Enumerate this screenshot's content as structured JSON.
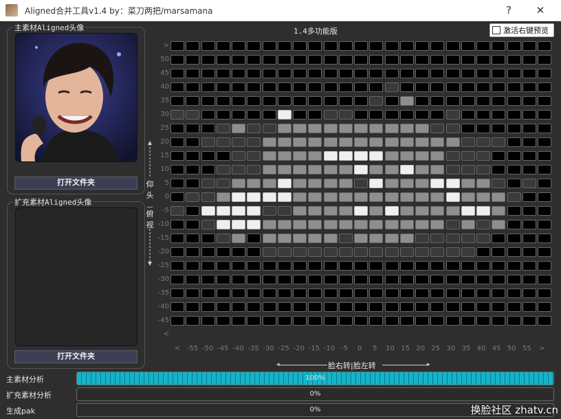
{
  "window": {
    "title": "Aligned合并工具v1.4  by：菜刀两把/marsamana",
    "help_label": "?",
    "close_label": "✕"
  },
  "left": {
    "main_panel_label": "主素材Aligned头像",
    "main_open_button": "打开文件夹",
    "ext_panel_label": "扩充素材Aligned头像",
    "ext_open_button": "打开文件夹",
    "pitch_label_top": "仰头",
    "pitch_label_bottom": "俯视"
  },
  "grid": {
    "mode_title": "1.4多功能版",
    "right_click_preview_label": "激活右键预览",
    "right_click_preview_checked": false,
    "yaw_axis_label": "脸右转|脸左转",
    "y_ticks": [
      ">",
      "50",
      "45",
      "40",
      "35",
      "30",
      "25",
      "20",
      "15",
      "10",
      "5",
      "0",
      "-5",
      "-10",
      "-15",
      "-20",
      "-25",
      "-30",
      "-35",
      "-40",
      "-45",
      "<"
    ],
    "x_ticks": [
      "<",
      "-55",
      "-50",
      "-45",
      "-40",
      "-35",
      "-30",
      "-25",
      "-20",
      "-15",
      "-10",
      "-5",
      "0",
      "5",
      "10",
      "15",
      "20",
      "25",
      "30",
      "35",
      "40",
      "45",
      "50",
      "55",
      ">"
    ],
    "cells": [
      "0000000000000000000000000",
      "0000000000000000000000000",
      "0000000000000000000000000",
      "0000000000000010000000000",
      "0000000000000102000000000",
      "1100000300110000001000000",
      "0001211222222222211000000",
      "0011112222222222222111000",
      "0000112222333322221110000",
      "0001112222223223221110000",
      "0011222322221322233221010",
      "0112333322222222223222100",
      "1033331122223232222332000",
      "0013332222222222221212000",
      "0001202222212222111110000",
      "0000001111111111111100000",
      "0000000000000000000000000",
      "0000000000000000000000000",
      "0000000000000000000000000",
      "0000000000000000000000000",
      "0000000000000000000000000"
    ],
    "cell_colors": [
      "#000000",
      "#3a3a3a",
      "#8e8e8e",
      "#efefef"
    ]
  },
  "progress": [
    {
      "label": "主素材分析",
      "percent": 100,
      "text": "100%"
    },
    {
      "label": "扩充素材分析",
      "percent": 0,
      "text": "0%"
    },
    {
      "label": "生成pak",
      "percent": 0,
      "text": "0%"
    }
  ],
  "watermark": "换脸社区 zhatv.cn"
}
